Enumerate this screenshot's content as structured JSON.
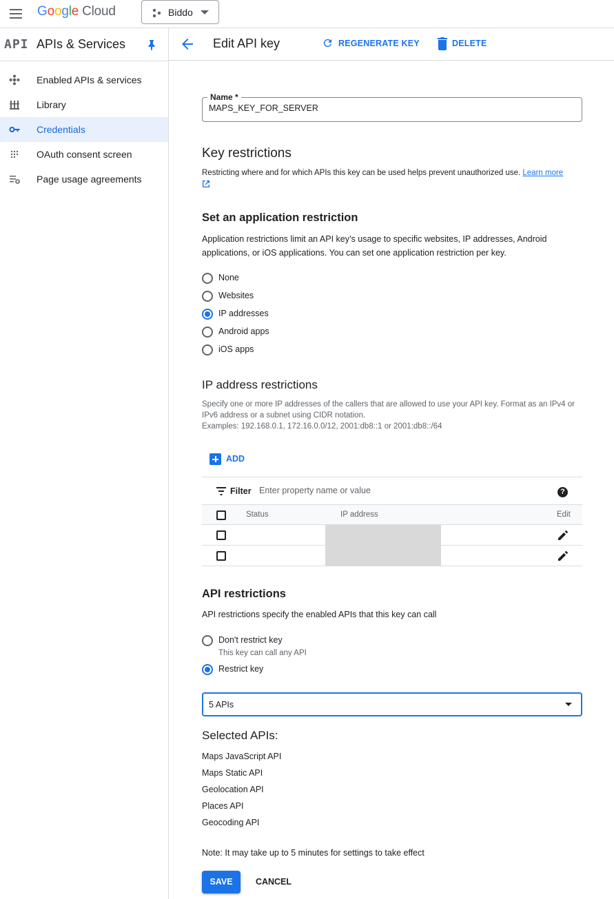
{
  "topbar": {
    "logo_letters": [
      "G",
      "o",
      "o",
      "g",
      "l",
      "e"
    ],
    "logo_suffix": "Cloud",
    "project_name": "Biddo"
  },
  "sidebar": {
    "badge": "API",
    "title": "APIs & Services",
    "items": [
      {
        "label": "Enabled APIs & services",
        "icon": "api-diamond-icon"
      },
      {
        "label": "Library",
        "icon": "library-icon"
      },
      {
        "label": "Credentials",
        "icon": "key-icon",
        "active": true
      },
      {
        "label": "OAuth consent screen",
        "icon": "consent-dots-icon"
      },
      {
        "label": "Page usage agreements",
        "icon": "settings-list-icon"
      }
    ]
  },
  "header": {
    "title": "Edit API key",
    "regenerate_label": "REGENERATE KEY",
    "delete_label": "DELETE"
  },
  "form": {
    "name_label": "Name *",
    "name_value": "MAPS_KEY_FOR_SERVER",
    "key_restrictions": {
      "title": "Key restrictions",
      "description": "Restricting where and for which APIs this key can be used helps prevent unauthorized use.",
      "learn_more": "Learn more"
    },
    "app_restriction": {
      "title": "Set an application restriction",
      "description": "Application restrictions limit an API key’s usage to specific websites, IP addresses, Android applications, or iOS applications. You can set one application restriction per key.",
      "options": [
        "None",
        "Websites",
        "IP addresses",
        "Android apps",
        "iOS apps"
      ],
      "selected": "IP addresses"
    },
    "ip_restrictions": {
      "title": "IP address restrictions",
      "description_1": "Specify one or more IP addresses of the callers that are allowed to use your API key. Format as an IPv4 or IPv6 address or a subnet using CIDR notation.",
      "description_2": "Examples: 192.168.0.1, 172.16.0.0/12, 2001:db8::1 or 2001:db8::/64",
      "add_label": "ADD",
      "filter_label": "Filter",
      "filter_placeholder": "Enter property name or value",
      "columns": [
        "Status",
        "IP address",
        "Edit"
      ],
      "row_count": 2
    },
    "api_restrictions": {
      "title": "API restrictions",
      "description": "API restrictions specify the enabled APIs that this key can call",
      "options": [
        {
          "label": "Don't restrict key",
          "sub": "This key can call any API"
        },
        {
          "label": "Restrict key",
          "sub": ""
        }
      ],
      "selected": "Restrict key",
      "dropdown_value": "5 APIs",
      "selected_title": "Selected APIs:",
      "selected_apis": [
        "Maps JavaScript API",
        "Maps Static API",
        "Geolocation API",
        "Places API",
        "Geocoding API"
      ]
    },
    "note": "Note: It may take up to 5 minutes for settings to take effect",
    "save_label": "SAVE",
    "cancel_label": "CANCEL"
  },
  "colors": {
    "accent": "#1a73e8",
    "active_nav_bg": "#e8f0fe",
    "divider": "#dadce0",
    "redaction": "#d9d9d9"
  }
}
